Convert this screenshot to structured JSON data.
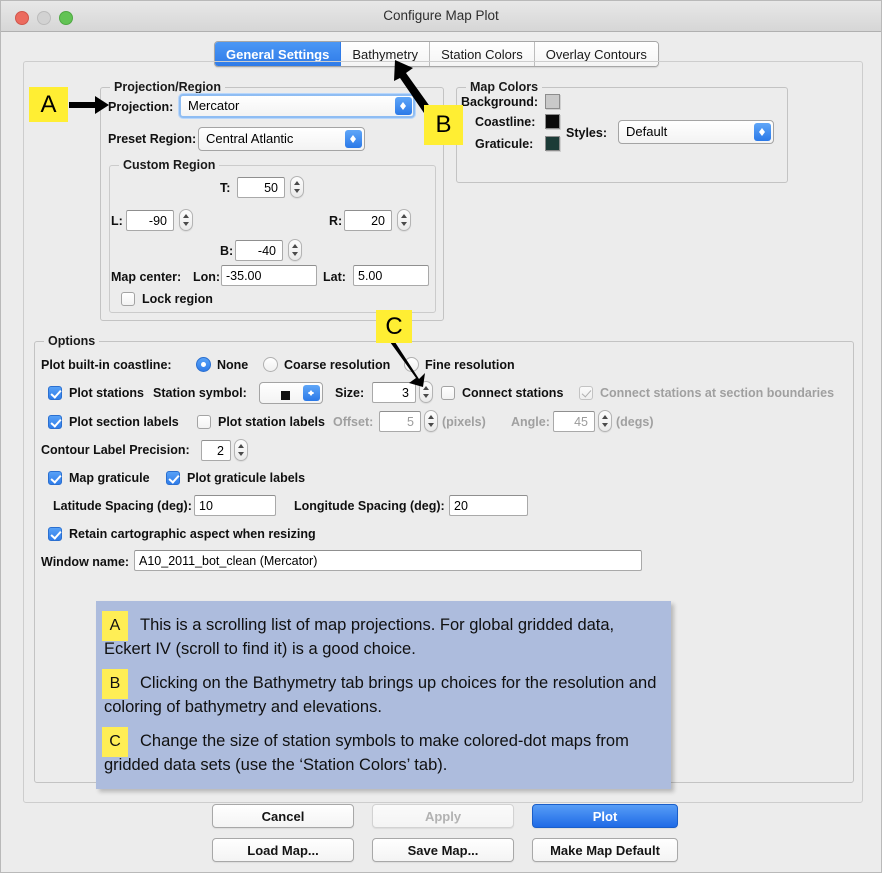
{
  "window": {
    "title": "Configure Map Plot",
    "traffic": {
      "close": "close-button",
      "minimize": "minimize-button",
      "maximize": "maximize-button"
    }
  },
  "tabs": [
    {
      "label": "General Settings",
      "active": true
    },
    {
      "label": "Bathymetry",
      "active": false
    },
    {
      "label": "Station Colors",
      "active": false
    },
    {
      "label": "Overlay Contours",
      "active": false
    }
  ],
  "projection_region": {
    "title": "Projection/Region",
    "projection_label": "Projection:",
    "projection_value": "Mercator",
    "preset_region_label": "Preset Region:",
    "preset_region_value": "Central Atlantic",
    "custom_region": {
      "title": "Custom Region",
      "top_label": "T:",
      "top_value": "50",
      "left_label": "L:",
      "left_value": "-90",
      "right_label": "R:",
      "right_value": "20",
      "bottom_label": "B:",
      "bottom_value": "-40",
      "map_center_label": "Map center:",
      "lon_label": "Lon:",
      "lon_value": "-35.00",
      "lat_label": "Lat:",
      "lat_value": "5.00",
      "lock_region_label": "Lock region",
      "lock_region_checked": false
    }
  },
  "map_colors": {
    "title": "Map Colors",
    "background_label": "Background:",
    "background_color": "#c9c9c9",
    "coastline_label": "Coastline:",
    "coastline_color": "#0a0a0a",
    "graticule_label": "Graticule:",
    "graticule_color": "#1c3b37",
    "styles_label": "Styles:",
    "styles_value": "Default"
  },
  "options": {
    "title": "Options",
    "coastline_label": "Plot built-in coastline:",
    "coastline_choices": [
      "None",
      "Coarse resolution",
      "Fine resolution"
    ],
    "coastline_selected": "None",
    "plot_stations_label": "Plot stations",
    "plot_stations_checked": true,
    "station_symbol_label": "Station symbol:",
    "station_symbol_value": "square",
    "size_label": "Size:",
    "size_value": "3",
    "connect_stations_label": "Connect stations",
    "connect_stations_checked": false,
    "connect_sections_label": "Connect stations at section boundaries",
    "connect_sections_checked": true,
    "connect_sections_enabled": false,
    "plot_section_labels_label": "Plot section labels",
    "plot_section_labels_checked": true,
    "plot_station_labels_label": "Plot station labels",
    "plot_station_labels_checked": false,
    "offset_label": "Offset:",
    "offset_value": "5",
    "pixels_unit": "(pixels)",
    "angle_label": "Angle:",
    "angle_value": "45",
    "degs_unit": "(degs)",
    "contour_precision_label": "Contour Label Precision:",
    "contour_precision_value": "2",
    "map_graticule_label": "Map graticule",
    "map_graticule_checked": true,
    "plot_graticule_labels_label": "Plot graticule labels",
    "plot_graticule_labels_checked": true,
    "lat_spacing_label": "Latitude Spacing (deg):",
    "lat_spacing_value": "10",
    "lon_spacing_label": "Longitude Spacing (deg):",
    "lon_spacing_value": "20",
    "retain_aspect_label": "Retain cartographic aspect when resizing",
    "retain_aspect_checked": true,
    "window_name_label": "Window name:",
    "window_name_value": "A10_2011_bot_clean (Mercator)"
  },
  "markers": [
    {
      "id": "A",
      "letter": "A"
    },
    {
      "id": "B",
      "letter": "B"
    },
    {
      "id": "C",
      "letter": "C"
    }
  ],
  "callout": [
    {
      "badge": "A",
      "text": "This is a scrolling list of map projections. For global gridded data, Eckert IV (scroll to find it) is a good choice."
    },
    {
      "badge": "B",
      "text": "Clicking on the Bathymetry tab brings up choices for the resolution and coloring of bathymetry and elevations."
    },
    {
      "badge": "C",
      "text": "Change the size of station symbols to make colored-dot maps from gridded data sets (use the ‘Station Colors’ tab)."
    }
  ],
  "footer": {
    "cancel": "Cancel",
    "apply": "Apply",
    "plot": "Plot",
    "load_map": "Load Map...",
    "save_map": "Save Map...",
    "make_default": "Make Map Default"
  },
  "colors": {
    "accent": "#2f7be8",
    "marker_yellow": "#ffee33",
    "callout_bg": "#adbcdd"
  }
}
